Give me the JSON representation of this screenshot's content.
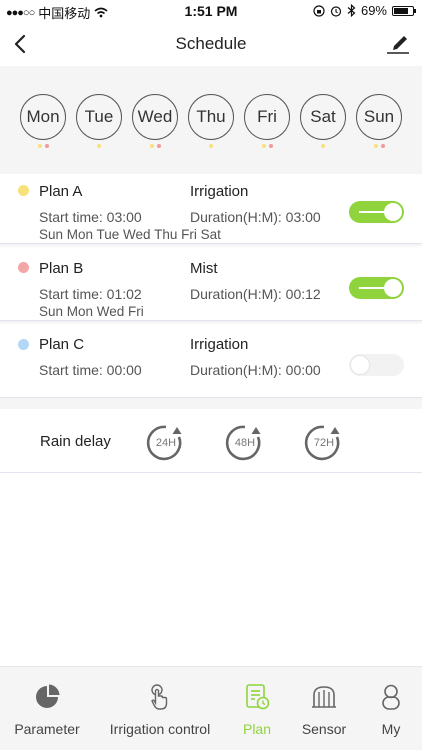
{
  "status_bar": {
    "carrier": "中国移动",
    "time": "1:51 PM",
    "battery": "69%"
  },
  "nav": {
    "title": "Schedule"
  },
  "days": [
    {
      "label": "Mon",
      "dots": [
        "#f7e27a",
        "#f09a9a"
      ]
    },
    {
      "label": "Tue",
      "dots": [
        "#f7e27a"
      ]
    },
    {
      "label": "Wed",
      "dots": [
        "#f7e27a",
        "#f09a9a"
      ]
    },
    {
      "label": "Thu",
      "dots": [
        "#f7e27a"
      ]
    },
    {
      "label": "Fri",
      "dots": [
        "#f7e27a",
        "#f09a9a"
      ]
    },
    {
      "label": "Sat",
      "dots": [
        "#f7e27a"
      ]
    },
    {
      "label": "Sun",
      "dots": [
        "#f7e27a",
        "#f09a9a"
      ]
    }
  ],
  "plans": [
    {
      "name": "Plan A",
      "color": "#f7e27a",
      "type": "Irrigation",
      "start": "Start time: 03:00",
      "duration": "Duration(H:M): 03:00",
      "days": "Sun Mon Tue Wed Thu Fri Sat",
      "enabled": true
    },
    {
      "name": "Plan B",
      "color": "#f2a6a6",
      "type": "Mist",
      "start": "Start time: 01:02",
      "duration": "Duration(H:M): 00:12",
      "days": "Sun Mon Wed Fri",
      "enabled": true
    },
    {
      "name": "Plan C",
      "color": "#b3d8f7",
      "type": "Irrigation",
      "start": "Start time: 00:00",
      "duration": "Duration(H:M): 00:00",
      "days": "",
      "enabled": false
    }
  ],
  "rain_delay": {
    "label": "Rain delay",
    "options": [
      "24H",
      "48H",
      "72H"
    ]
  },
  "tabs": [
    {
      "label": "Parameter",
      "icon": "pie-chart-icon",
      "active": false
    },
    {
      "label": "Irrigation control",
      "icon": "touch-hand-icon",
      "active": false
    },
    {
      "label": "Plan",
      "icon": "plan-clock-icon",
      "active": true
    },
    {
      "label": "Sensor",
      "icon": "sensor-icon",
      "active": false
    },
    {
      "label": "My",
      "icon": "user-icon",
      "active": false
    }
  ],
  "colors": {
    "accent": "#8fd43c",
    "background": "#f5f5f5"
  }
}
